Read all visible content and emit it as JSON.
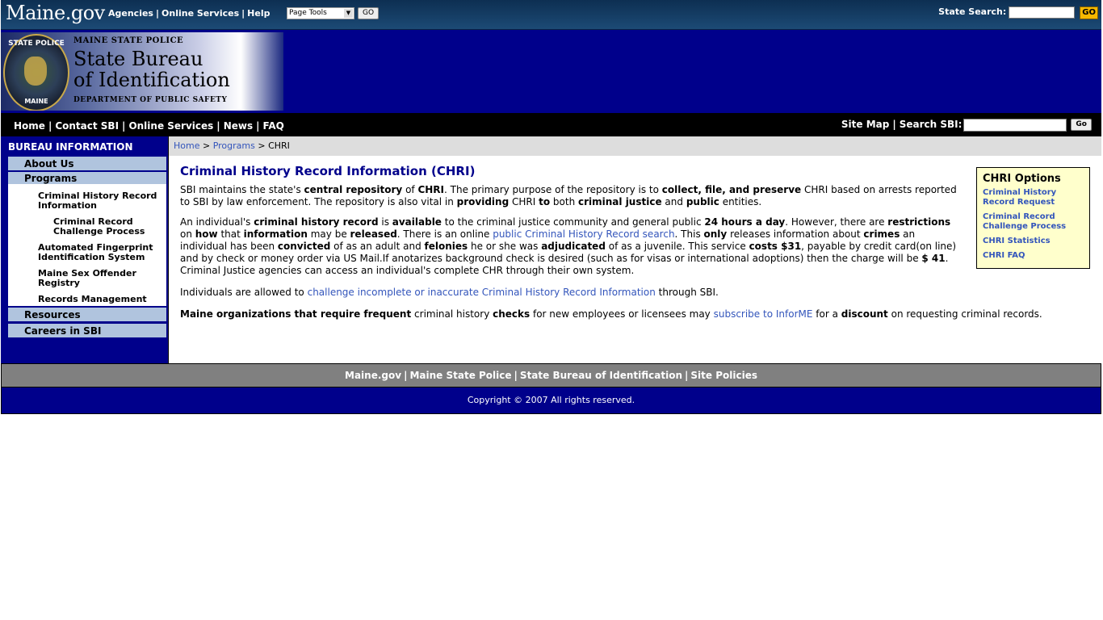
{
  "topbar": {
    "logo": "Maine.gov",
    "links": [
      "Agencies",
      "Online Services",
      "Help"
    ],
    "page_tools": "Page Tools",
    "go_label": "GO",
    "state_search_label": "State Search:",
    "state_search_go": "GO"
  },
  "banner": {
    "line1": "MAINE STATE POLICE",
    "line2": "State Bureau",
    "line3": "of Identification",
    "line4": "DEPARTMENT OF PUBLIC SAFETY",
    "seal_top": "STATE POLICE",
    "seal_bottom": "MAINE"
  },
  "navbar": {
    "links": [
      "Home",
      "Contact SBI",
      "Online Services",
      "News",
      "FAQ"
    ],
    "site_map": "Site Map",
    "search_label": "Search SBI:",
    "go_label": "Go"
  },
  "sidebar": {
    "heading": "BUREAU INFORMATION",
    "about": "About Us",
    "programs": "Programs",
    "chri": "Criminal History Record Information",
    "challenge": "Criminal Record Challenge Process",
    "afis": "Automated Fingerprint Identification System",
    "sex_offender": "Maine Sex Offender Registry",
    "records": "Records Management",
    "resources": "Resources",
    "careers": "Careers in SBI"
  },
  "breadcrumb": {
    "home": "Home",
    "programs": "Programs",
    "current": "CHRI",
    "sep": ">"
  },
  "article": {
    "title": "Criminal History Record Information (CHRI)",
    "p4_link": "challenge incomplete or inaccurate Criminal History Record Information",
    "p2_link": "public Criminal History Record search",
    "p5_link": "subscribe to InforME"
  },
  "options": {
    "title": "CHRI Options",
    "links": [
      "Criminal History Record Request",
      "Criminal Record Challenge Process",
      "CHRI Statistics",
      "CHRI FAQ"
    ]
  },
  "footer": {
    "links": [
      "Maine.gov",
      "Maine State Police",
      "State Bureau of Identification",
      "Site Policies"
    ],
    "copyright": "Copyright © 2007 All rights reserved."
  }
}
